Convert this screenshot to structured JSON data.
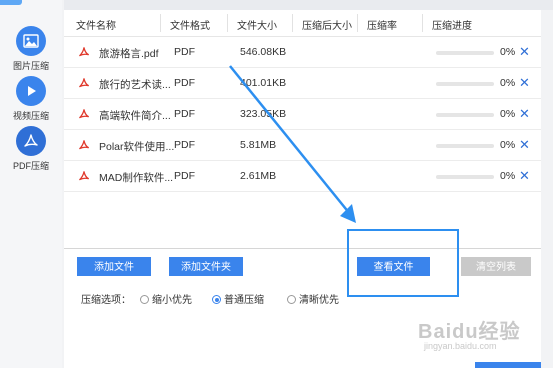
{
  "sidebar": {
    "items": [
      {
        "label": "图片压缩",
        "icon": "image-icon",
        "active": false
      },
      {
        "label": "视频压缩",
        "icon": "play-icon",
        "active": false
      },
      {
        "label": "PDF压缩",
        "icon": "pdf-icon",
        "active": true
      }
    ]
  },
  "table": {
    "columns": [
      "文件名称",
      "文件格式",
      "文件大小",
      "压缩后大小",
      "压缩率",
      "压缩进度"
    ],
    "rows": [
      {
        "name": "旅游格言.pdf",
        "format": "PDF",
        "size": "546.08KB",
        "progress": 0,
        "progress_text": "0%"
      },
      {
        "name": "旅行的艺术读...",
        "format": "PDF",
        "size": "401.01KB",
        "progress": 0,
        "progress_text": "0%"
      },
      {
        "name": "高端软件简介...",
        "format": "PDF",
        "size": "323.05KB",
        "progress": 0,
        "progress_text": "0%"
      },
      {
        "name": "Polar软件使用...",
        "format": "PDF",
        "size": "5.81MB",
        "progress": 0,
        "progress_text": "0%"
      },
      {
        "name": "MAD制作软件...",
        "format": "PDF",
        "size": "2.61MB",
        "progress": 0,
        "progress_text": "0%"
      }
    ]
  },
  "buttons": {
    "add_file": "添加文件",
    "add_folder": "添加文件夹",
    "view_files": "查看文件",
    "clear_list": "清空列表"
  },
  "options": {
    "label": "压缩选项：",
    "choices": [
      {
        "label": "缩小优先",
        "selected": false
      },
      {
        "label": "普通压缩",
        "selected": true
      },
      {
        "label": "清晰优先",
        "selected": false
      }
    ]
  },
  "colors": {
    "accent": "#3a84ec",
    "annotation": "#2d8ff0"
  },
  "watermark": {
    "main": "Baidu经验",
    "sub": "jingyan.baidu.com"
  }
}
